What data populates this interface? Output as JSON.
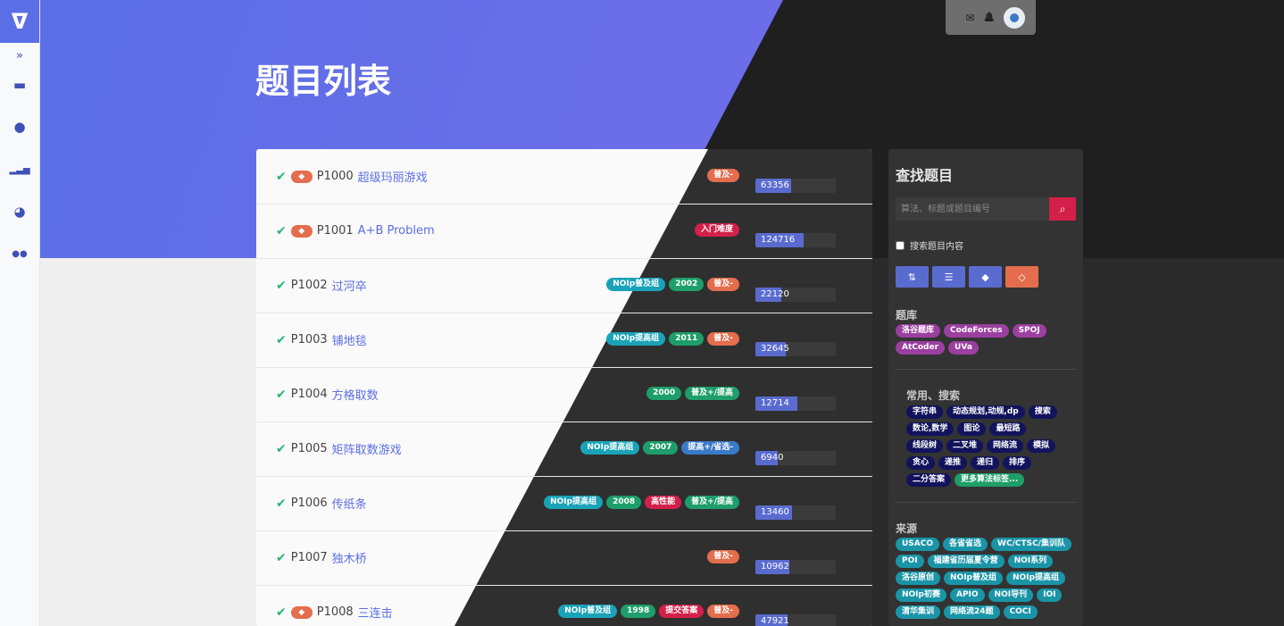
{
  "app": {
    "logo": "ᐁ"
  },
  "sidebar": {
    "items": [
      {
        "name": "expand-icon",
        "glyph": "»"
      },
      {
        "name": "book-icon",
        "glyph": "▬"
      },
      {
        "name": "bulb-icon",
        "glyph": "●"
      },
      {
        "name": "signal-icon",
        "glyph": "▂▃▅"
      },
      {
        "name": "pie-chart-icon",
        "glyph": "◕"
      },
      {
        "name": "chat-icon",
        "glyph": "●●"
      }
    ]
  },
  "userbar": {
    "mail_icon": "✉",
    "bell_icon": "🔔"
  },
  "page": {
    "title": "题目列表"
  },
  "problems": [
    {
      "id": "P1000",
      "title": "超级玛丽游戏",
      "gem": true,
      "tags": [
        {
          "text": "普及-",
          "color": "#e46d4d"
        }
      ],
      "passed": "63356",
      "fill": 0.44
    },
    {
      "id": "P1001",
      "title": "A+B Problem",
      "gem": true,
      "tags": [
        {
          "text": "入门难度",
          "color": "#d3204a"
        }
      ],
      "passed": "124716",
      "fill": 0.6
    },
    {
      "id": "P1002",
      "title": "过河卒",
      "gem": false,
      "tags": [
        {
          "text": "NOIp普及组",
          "color": "#1aa3b8"
        },
        {
          "text": "2002",
          "color": "#1e9e6a"
        },
        {
          "text": "普及-",
          "color": "#e46d4d"
        }
      ],
      "passed": "22120",
      "fill": 0.32
    },
    {
      "id": "P1003",
      "title": "铺地毯",
      "gem": false,
      "tags": [
        {
          "text": "NOIp提高组",
          "color": "#1aa3b8"
        },
        {
          "text": "2011",
          "color": "#1e9e6a"
        },
        {
          "text": "普及-",
          "color": "#e46d4d"
        }
      ],
      "passed": "32645",
      "fill": 0.38
    },
    {
      "id": "P1004",
      "title": "方格取数",
      "gem": false,
      "tags": [
        {
          "text": "2000",
          "color": "#1e9e6a"
        },
        {
          "text": "普及+/提高",
          "color": "#1e9e6a"
        }
      ],
      "passed": "12714",
      "fill": 0.52
    },
    {
      "id": "P1005",
      "title": "矩阵取数游戏",
      "gem": false,
      "tags": [
        {
          "text": "NOIp提高组",
          "color": "#1aa3b8"
        },
        {
          "text": "2007",
          "color": "#1e9e6a"
        },
        {
          "text": "提高+/省选-",
          "color": "#3b79c9"
        }
      ],
      "passed": "6940",
      "fill": 0.28
    },
    {
      "id": "P1006",
      "title": "传纸条",
      "gem": false,
      "tags": [
        {
          "text": "NOIp提高组",
          "color": "#1aa3b8"
        },
        {
          "text": "2008",
          "color": "#1e9e6a"
        },
        {
          "text": "高性能",
          "color": "#d3204a"
        },
        {
          "text": "普及+/提高",
          "color": "#1e9e6a"
        }
      ],
      "passed": "13460",
      "fill": 0.46
    },
    {
      "id": "P1007",
      "title": "独木桥",
      "gem": false,
      "tags": [
        {
          "text": "普及-",
          "color": "#e46d4d"
        }
      ],
      "passed": "10962",
      "fill": 0.42
    },
    {
      "id": "P1008",
      "title": "三连击",
      "gem": true,
      "tags": [
        {
          "text": "NOIp普及组",
          "color": "#1aa3b8"
        },
        {
          "text": "1998",
          "color": "#1e9e6a"
        },
        {
          "text": "提交答案",
          "color": "#d3204a"
        },
        {
          "text": "普及-",
          "color": "#e46d4d"
        }
      ],
      "passed": "47921",
      "fill": 0.4
    }
  ],
  "panel": {
    "title": "查找题目",
    "search_placeholder": "算法、标题或题目编号",
    "search_content_label": "搜索题目内容",
    "tools": [
      "sort-numeric-icon",
      "sort-bars-icon",
      "tags-icon",
      "gem-icon"
    ],
    "sections": [
      {
        "title": "题库",
        "chips": [
          {
            "text": "洛谷题库",
            "color": "#9b3fa0"
          },
          {
            "text": "CodeForces",
            "color": "#9b3fa0"
          },
          {
            "text": "SPOJ",
            "color": "#9b3fa0"
          },
          {
            "text": "AtCoder",
            "color": "#9b3fa0"
          },
          {
            "text": "UVa",
            "color": "#9b3fa0"
          }
        ]
      },
      {
        "title": "常用、搜索",
        "chips": [
          {
            "text": "字符串",
            "color": "#12135c"
          },
          {
            "text": "动态规划,动规,dp",
            "color": "#12135c"
          },
          {
            "text": "搜索",
            "color": "#12135c"
          },
          {
            "text": "数论,数学",
            "color": "#12135c"
          },
          {
            "text": "图论",
            "color": "#12135c"
          },
          {
            "text": "最短路",
            "color": "#12135c"
          },
          {
            "text": "线段树",
            "color": "#12135c"
          },
          {
            "text": "二叉堆",
            "color": "#12135c"
          },
          {
            "text": "网络流",
            "color": "#12135c"
          },
          {
            "text": "模拟",
            "color": "#12135c"
          },
          {
            "text": "贪心",
            "color": "#12135c"
          },
          {
            "text": "递推",
            "color": "#12135c"
          },
          {
            "text": "递归",
            "color": "#12135c"
          },
          {
            "text": "排序",
            "color": "#12135c"
          },
          {
            "text": "二分答案",
            "color": "#12135c"
          },
          {
            "text": "更多算法标签...",
            "color": "#1e9e6a"
          }
        ]
      },
      {
        "title": "来源",
        "chips": [
          {
            "text": "USACO",
            "color": "#1a95a8"
          },
          {
            "text": "各省省选",
            "color": "#1a95a8"
          },
          {
            "text": "WC/CTSC/集训队",
            "color": "#1a95a8"
          },
          {
            "text": "POI",
            "color": "#1a95a8"
          },
          {
            "text": "福建省历届夏令营",
            "color": "#1a95a8"
          },
          {
            "text": "NOI系列",
            "color": "#1a95a8"
          },
          {
            "text": "洛谷原创",
            "color": "#1a95a8"
          },
          {
            "text": "NOIp普及组",
            "color": "#1a95a8"
          },
          {
            "text": "NOIp提高组",
            "color": "#1a95a8"
          },
          {
            "text": "NOIp初赛",
            "color": "#1a95a8"
          },
          {
            "text": "APIO",
            "color": "#1a95a8"
          },
          {
            "text": "NOI导刊",
            "color": "#1a95a8"
          },
          {
            "text": "IOI",
            "color": "#1a95a8"
          },
          {
            "text": "清华集训",
            "color": "#1a95a8"
          },
          {
            "text": "网络流24题",
            "color": "#1a95a8"
          },
          {
            "text": "COCI",
            "color": "#1a95a8"
          }
        ]
      }
    ]
  },
  "colors": {
    "accent": "#5b6ee5",
    "dark": "#1f1f1f",
    "check": "#2bb673"
  }
}
